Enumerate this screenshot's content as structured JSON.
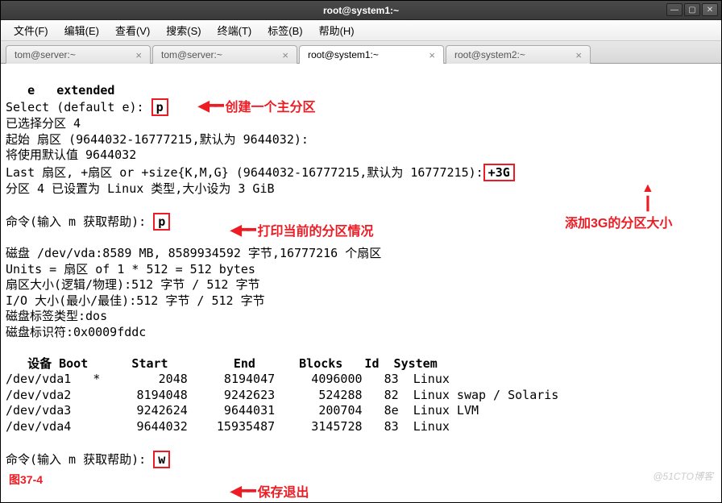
{
  "window": {
    "title": "root@system1:~"
  },
  "menu": {
    "file": "文件(F)",
    "edit": "编辑(E)",
    "view": "查看(V)",
    "search": "搜索(S)",
    "terminal": "终端(T)",
    "tabs": "标签(B)",
    "help": "帮助(H)"
  },
  "tabs": [
    {
      "label": "tom@server:~",
      "active": false
    },
    {
      "label": "tom@server:~",
      "active": false
    },
    {
      "label": "root@system1:~",
      "active": true
    },
    {
      "label": "root@system2:~",
      "active": false
    }
  ],
  "term": {
    "l1": "   e   extended",
    "l2a": "Select (default e): ",
    "p1": "p",
    "l3": "已选择分区 4",
    "l4": "起始 扇区 (9644032-16777215,默认为 9644032):",
    "l5": "将使用默认值 9644032",
    "l6a": "Last 扇区, +扇区 or +size{K,M,G} (9644032-16777215,默认为 16777215):",
    "size": "+3G",
    "l7": "分区 4 已设置为 Linux 类型,大小设为 3 GiB",
    "l8a": "命令(输入 m 获取帮助): ",
    "p2": "p",
    "l9": "磁盘 /dev/vda:8589 MB, 8589934592 字节,16777216 个扇区",
    "l10": "Units = 扇区 of 1 * 512 = 512 bytes",
    "l11": "扇区大小(逻辑/物理):512 字节 / 512 字节",
    "l12": "I/O 大小(最小/最佳):512 字节 / 512 字节",
    "l13": "磁盘标签类型:dos",
    "l14": "磁盘标识符:0x0009fddc",
    "thead": "   设备 Boot      Start         End      Blocks   Id  System",
    "r1": "/dev/vda1   *        2048     8194047     4096000   83  Linux",
    "r2": "/dev/vda2         8194048     9242623      524288   82  Linux swap / Solaris",
    "r3": "/dev/vda3         9242624     9644031      200704   8e  Linux LVM",
    "r4": "/dev/vda4         9644032    15935487     3145728   83  Linux",
    "l15a": "命令(输入 m 获取帮助): ",
    "w": "w"
  },
  "annotations": {
    "a1": "创建一个主分区",
    "a2": "添加3G的分区大小",
    "a3": "打印当前的分区情况",
    "a4": "保存退出",
    "fig": "图37-4",
    "watermark": "@51CTO博客"
  }
}
